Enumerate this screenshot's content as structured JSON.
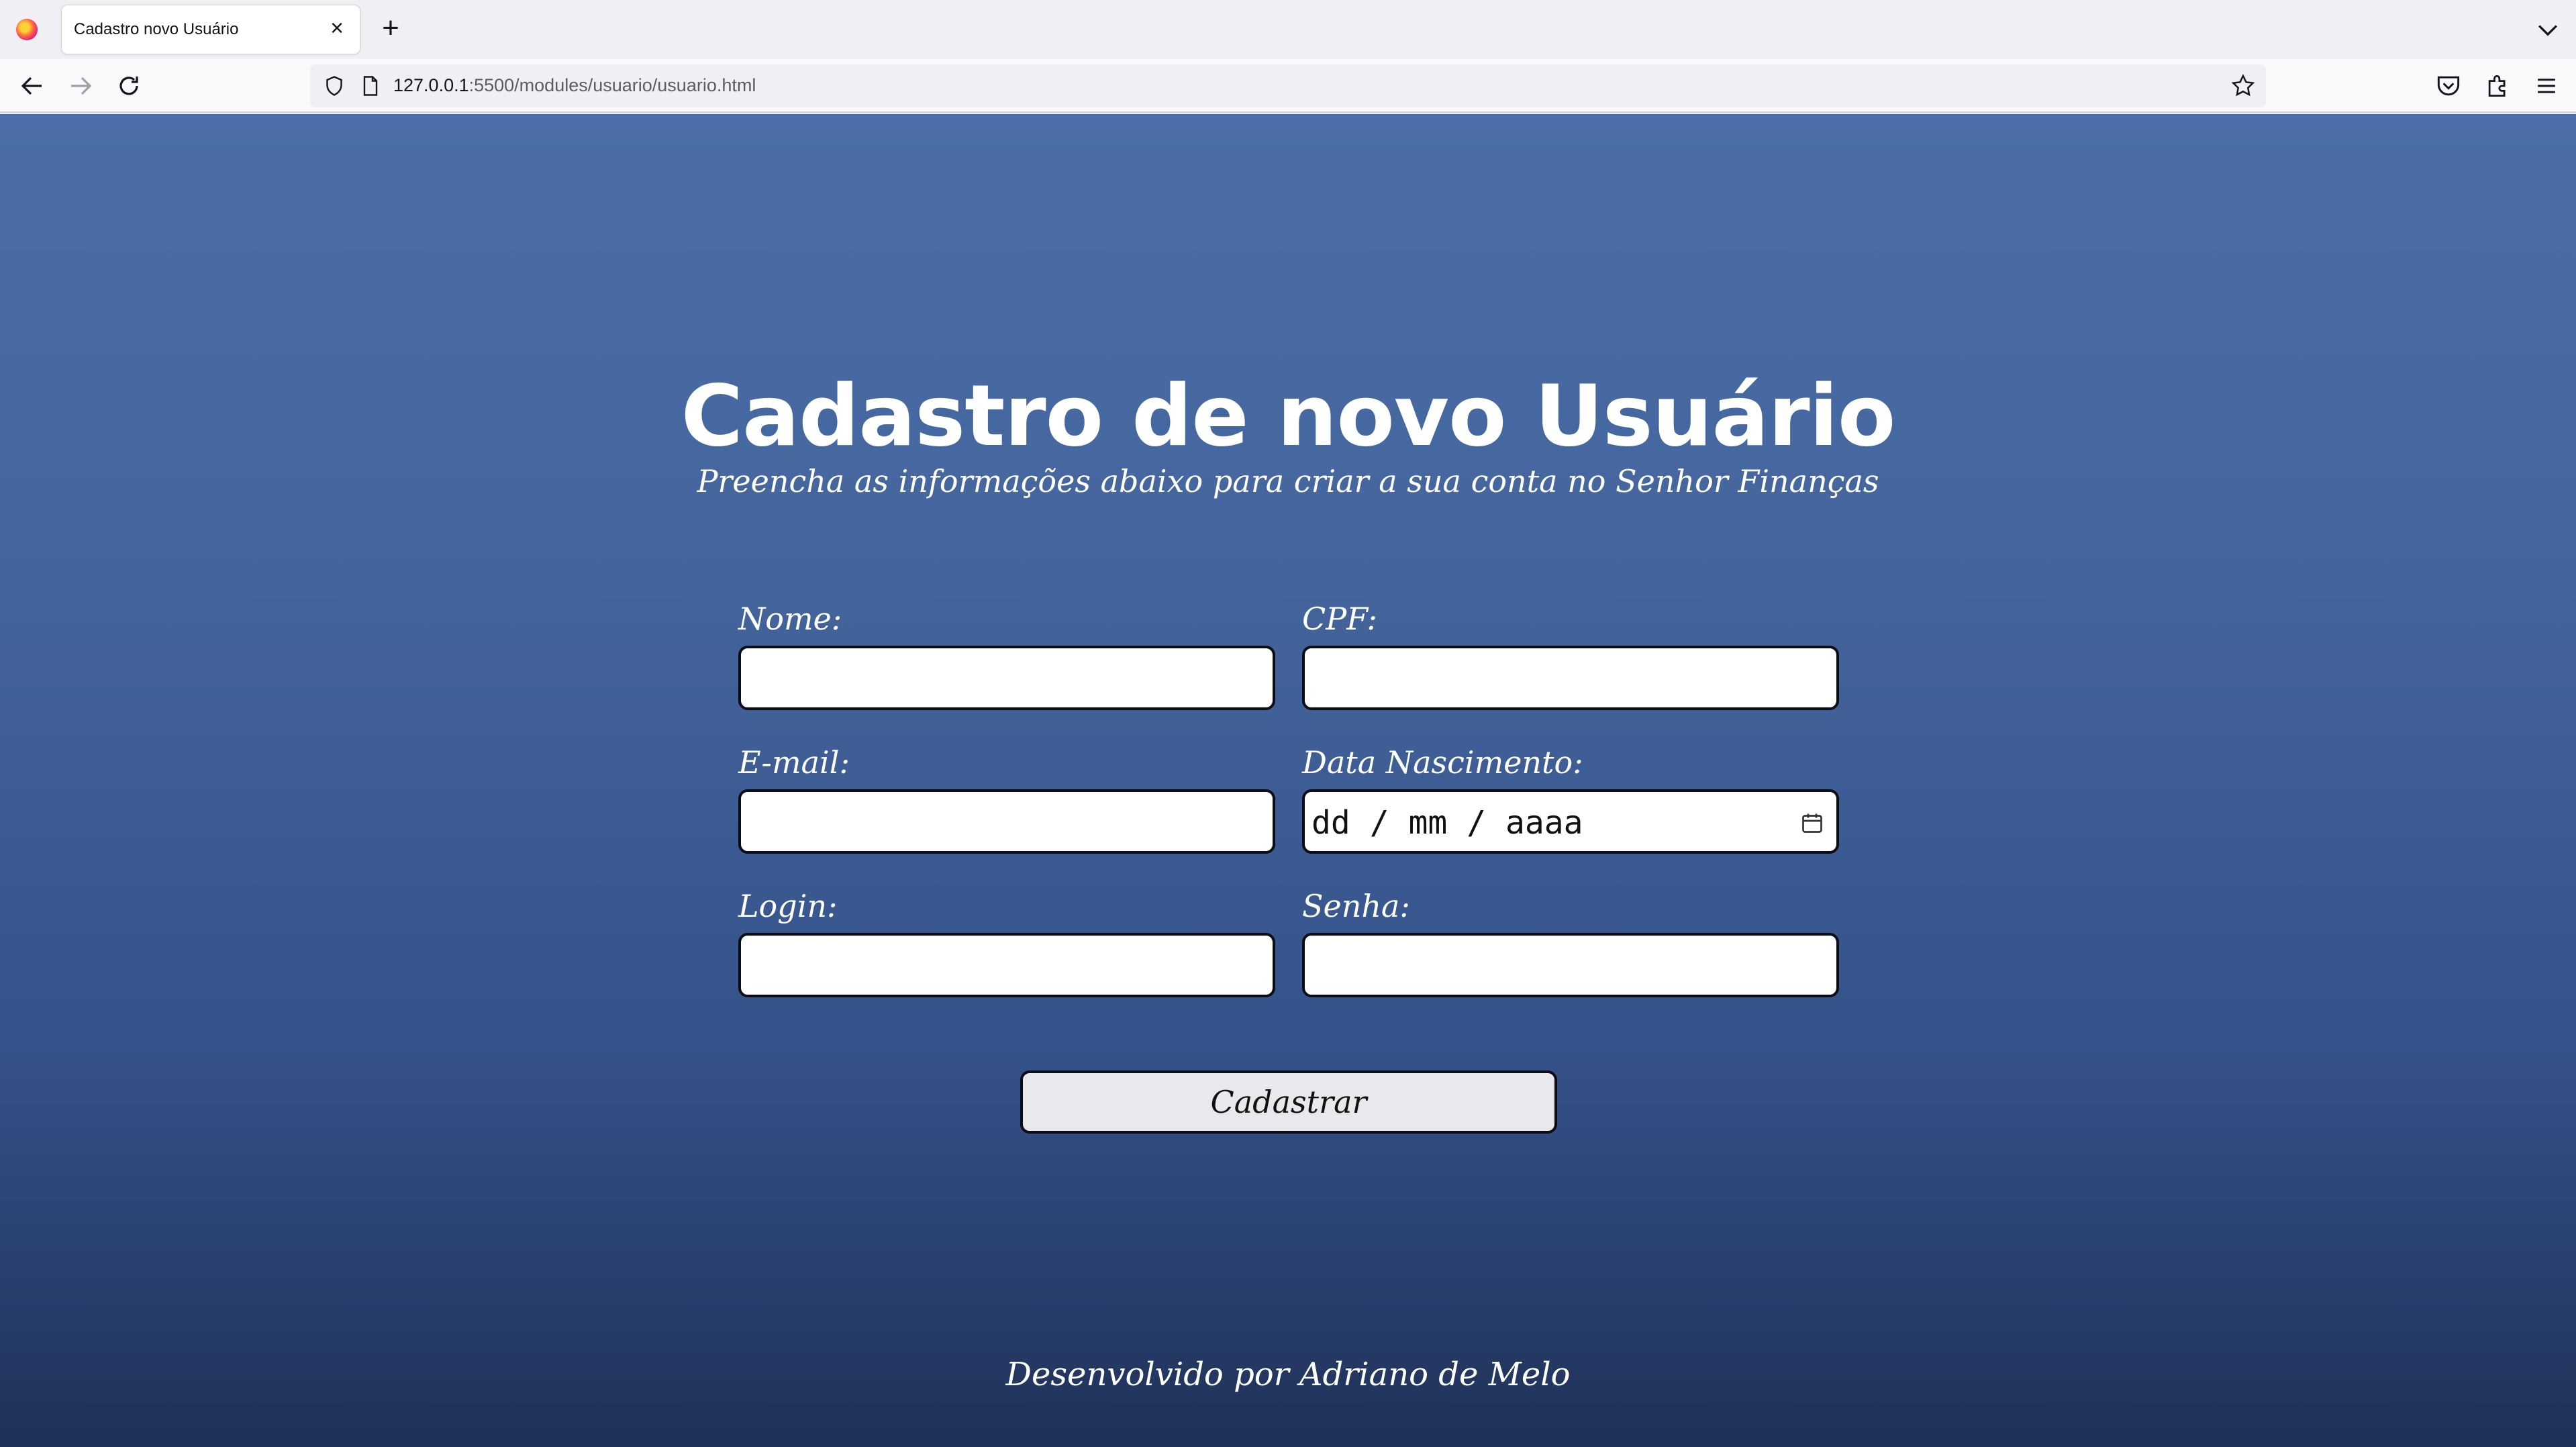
{
  "browser": {
    "tab_title": "Cadastro novo Usuário",
    "new_tab_label": "+",
    "tab_close_label": "×",
    "url_host": "127.0.0.1",
    "url_rest": ":5500/modules/usuario/usuario.html"
  },
  "header": {
    "title": "Cadastro de novo Usuário",
    "subtitle": "Preencha as informações abaixo para criar a sua conta no Senhor Finanças"
  },
  "form": {
    "nome_label": "Nome:",
    "cpf_label": "CPF:",
    "email_label": "E-mail:",
    "nascimento_label": "Data Nascimento:",
    "nascimento_placeholder": "dd / mm / aaaa",
    "login_label": "Login:",
    "senha_label": "Senha:",
    "submit_label": "Cadastrar"
  },
  "footer": {
    "credit": "Desenvolvido por Adriano de Melo"
  },
  "colors": {
    "bg_top": "#4b6ea8",
    "bg_bottom": "#1f3158",
    "input_border": "#0c0c14",
    "button_bg": "#e9e9ed"
  }
}
